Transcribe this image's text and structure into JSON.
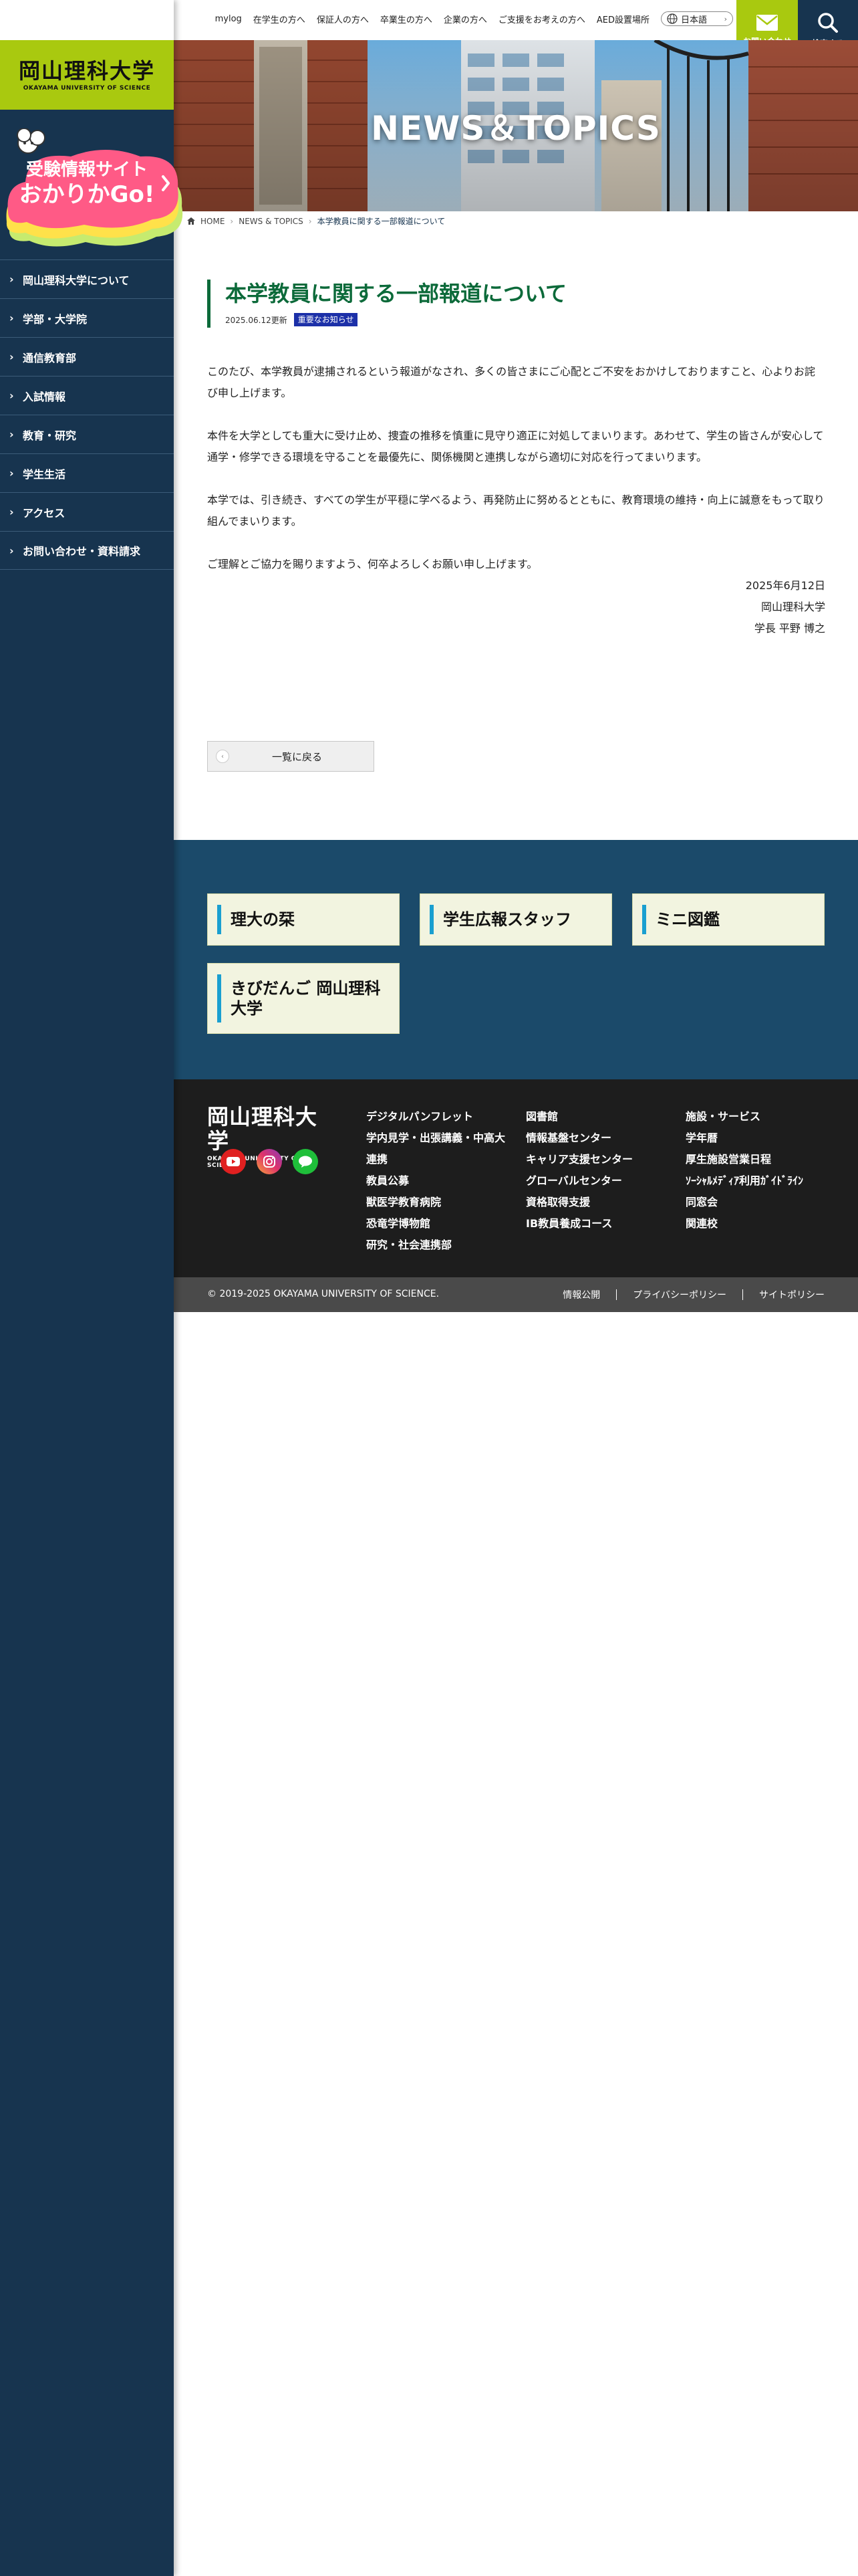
{
  "site": {
    "logo_ja": "岡山理科大学",
    "logo_en": "OKAYAMA UNIVERSITY OF SCIENCE",
    "accent_color": "#a9c90f",
    "navy_color": "#17344f"
  },
  "topbar": {
    "links": [
      "mylog",
      "在学生の方へ",
      "保証人の方へ",
      "卒業生の方へ",
      "企業の方へ",
      "ご支援をお考えの方へ",
      "AED設置場所"
    ],
    "language": "日本語",
    "contact_label": "お問い合わせ",
    "search_label": "検索する"
  },
  "exam_banner": {
    "line1": "受験情報サイト",
    "line2": "おかりかGo!"
  },
  "sidebar": {
    "items": [
      "岡山理科大学について",
      "学部・大学院",
      "通信教育部",
      "入試情報",
      "教育・研究",
      "学生生活",
      "アクセス",
      "お問い合わせ・資料請求"
    ]
  },
  "hero": {
    "title": "NEWS＆TOPICS"
  },
  "breadcrumb": {
    "home": "HOME",
    "section": "NEWS & TOPICS",
    "current": "本学教員に関する一部報道について"
  },
  "article": {
    "title": "本学教員に関する一部報道について",
    "date": "2025.06.12更新",
    "category": "重要なお知らせ",
    "paragraphs": [
      "このたび、本学教員が逮捕されるという報道がなされ、多くの皆さまにご心配とご不安をおかけしておりますこと、心よりお詫び申し上げます。",
      "本件を大学としても重大に受け止め、捜査の推移を慎重に見守り適正に対処してまいります。あわせて、学生の皆さんが安心して通学・修学できる環境を守ることを最優先に、関係機関と連携しながら適切に対応を行ってまいります。",
      "本学では、引き続き、すべての学生が平穏に学べるよう、再発防止に努めるとともに、教育環境の維持・向上に誠意をもって取り組んでまいります。",
      "ご理解とご協力を賜りますよう、何卒よろしくお願い申し上げます。"
    ],
    "sign_date": "2025年6月12日",
    "sign_org": "岡山理科大学",
    "sign_name": "学長 平野 博之",
    "back_label": "一覧に戻る"
  },
  "features": [
    "理大の栞",
    "学生広報スタッフ",
    "ミニ図鑑",
    "きびだんご 岡山理科大学"
  ],
  "footer": {
    "col1": [
      "デジタルパンフレット",
      "学内見学・出張講義・中高大連携",
      "教員公募",
      "獣医学教育病院",
      "恐竜学博物館",
      "研究・社会連携部"
    ],
    "col2": [
      "図書館",
      "情報基盤センター",
      "キャリア支援センター",
      "グローバルセンター",
      "資格取得支援",
      "IB教員養成コース"
    ],
    "col3": [
      "施設・サービス",
      "学年暦",
      "厚生施設営業日程",
      "ｿｰｼｬﾙﾒﾃﾞｨｱ利用ｶﾞｲﾄﾞﾗｲﾝ",
      "同窓会",
      "関連校"
    ],
    "copyright": "© 2019-2025 OKAYAMA UNIVERSITY OF SCIENCE.",
    "legal": [
      "情報公開",
      "プライバシーポリシー",
      "サイトポリシー"
    ]
  }
}
